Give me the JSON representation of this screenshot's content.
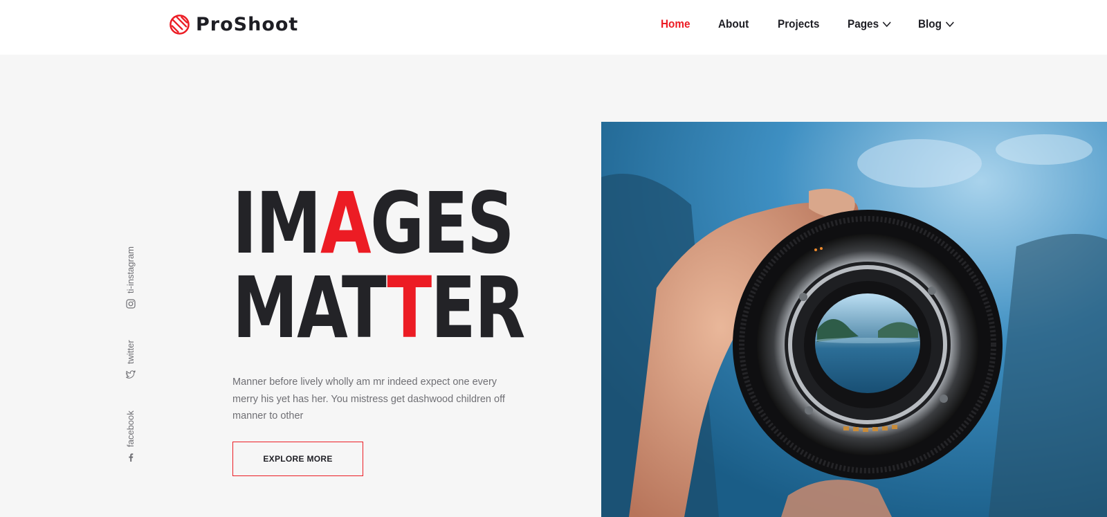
{
  "brand": {
    "name": "ProShoot",
    "accent_color": "#ec1c24",
    "dark_color": "#232327"
  },
  "nav": {
    "items": [
      {
        "label": "Home",
        "active": true,
        "has_dropdown": false
      },
      {
        "label": "About",
        "active": false,
        "has_dropdown": false
      },
      {
        "label": "Projects",
        "active": false,
        "has_dropdown": false
      },
      {
        "label": "Pages",
        "active": false,
        "has_dropdown": true
      },
      {
        "label": "Blog",
        "active": false,
        "has_dropdown": true
      }
    ]
  },
  "hero": {
    "title_line1": {
      "before": "IM",
      "accent": "A",
      "after": "GES"
    },
    "title_line2": {
      "before": "MAT",
      "accent": "T",
      "after": "ER"
    },
    "description": "Manner before lively wholly am mr indeed expect one every merry his yet has her. You mistress get dashwood children off manner to other",
    "button_label": "EXPLORE MORE"
  },
  "social": [
    {
      "label": "ti-instagram",
      "icon": "instagram-icon"
    },
    {
      "label": "twitter",
      "icon": "twitter-icon"
    },
    {
      "label": "facebook",
      "icon": "facebook-icon"
    }
  ]
}
